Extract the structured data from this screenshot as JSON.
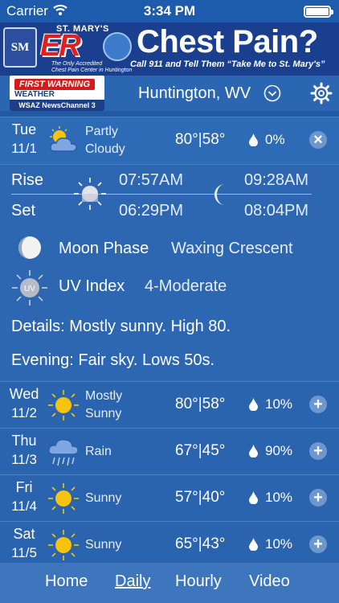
{
  "status": {
    "carrier": "Carrier",
    "time": "3:34 PM"
  },
  "ad": {
    "logo": "SM",
    "brand": "ST. MARY'S",
    "er": "ER",
    "tagline1": "The Only Accredited",
    "tagline2": "Chest Pain Center in Huntington",
    "headline": "Chest Pain?",
    "call": "Call 911 and Tell Them “Take Me to St. Mary's”"
  },
  "header": {
    "logo_top": "FIRST WARNING",
    "logo_mid": "WEATHER",
    "logo_bottom": "WSAZ NewsChannel 3",
    "location": "Huntington, WV"
  },
  "days": [
    {
      "dow": "Tue",
      "date": "11/1",
      "cond1": "Partly",
      "cond2": "Cloudy",
      "temp": "80°|58°",
      "precip": "0%",
      "icon": "partly-cloudy-icon",
      "action": "×"
    },
    {
      "dow": "Wed",
      "date": "11/2",
      "cond1": "Mostly",
      "cond2": "Sunny",
      "temp": "80°|58°",
      "precip": "10%",
      "icon": "sun-icon",
      "action": "+"
    },
    {
      "dow": "Thu",
      "date": "11/3",
      "cond1": "Rain",
      "cond2": "",
      "temp": "67°|45°",
      "precip": "90%",
      "icon": "rain-icon",
      "action": "+"
    },
    {
      "dow": "Fri",
      "date": "11/4",
      "cond1": "Sunny",
      "cond2": "",
      "temp": "57°|40°",
      "precip": "10%",
      "icon": "sun-icon",
      "action": "+"
    },
    {
      "dow": "Sat",
      "date": "11/5",
      "cond1": "Sunny",
      "cond2": "",
      "temp": "65°|43°",
      "precip": "10%",
      "icon": "sun-icon",
      "action": "+"
    }
  ],
  "detail": {
    "rise_label": "Rise",
    "set_label": "Set",
    "sunrise": "07:57AM",
    "sunset": "06:29PM",
    "moonrise": "09:28AM",
    "moonset": "08:04PM",
    "moon_phase_label": "Moon Phase",
    "moon_phase": "Waxing Crescent",
    "uv_label": "UV Index",
    "uv_badge": "UV",
    "uv_value": "4-Moderate",
    "details": "Details: Mostly sunny.  High 80.",
    "evening": "Evening: Fair sky. Lows 50s."
  },
  "nav": {
    "home": "Home",
    "daily": "Daily",
    "hourly": "Hourly",
    "video": "Video"
  }
}
